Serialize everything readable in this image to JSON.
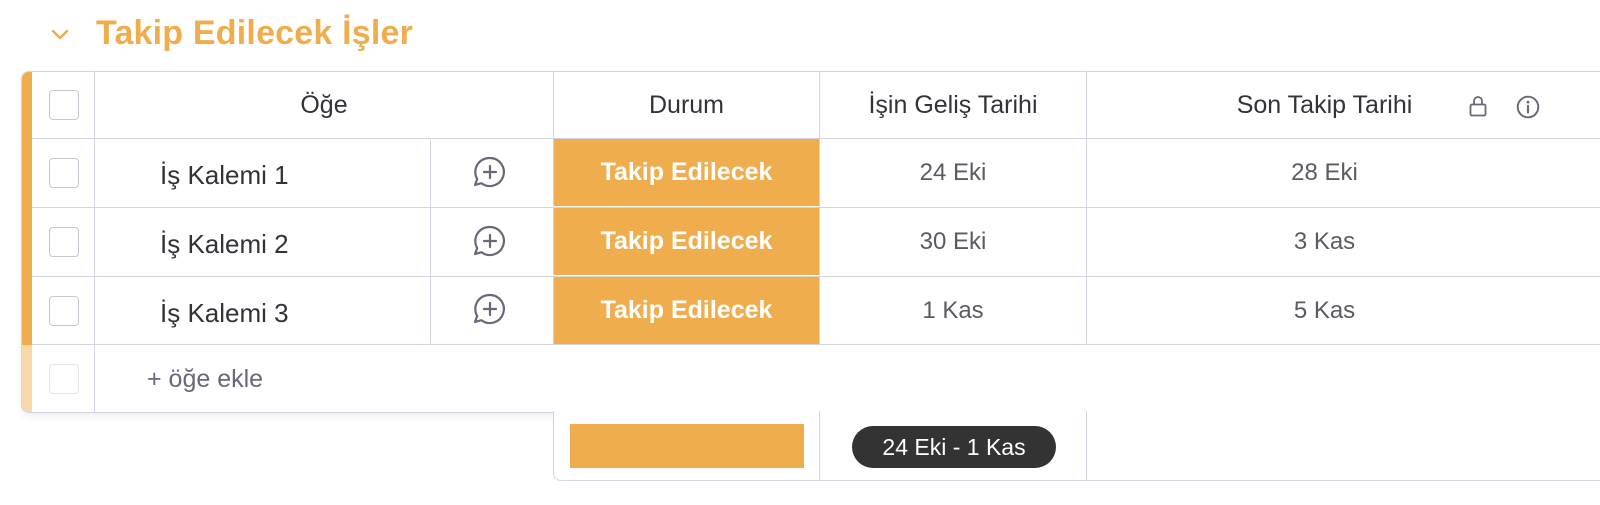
{
  "group": {
    "title": "Takip Edilecek İşler",
    "color": "#f0ad4e"
  },
  "columns": {
    "item": "Öğe",
    "status": "Durum",
    "arrival_date": "İşin Geliş Tarihi",
    "last_followup": "Son Takip Tarihi"
  },
  "rows": [
    {
      "name": "İş Kalemi 1",
      "status": "Takip Edilecek",
      "arrival_date": "24 Eki",
      "last_followup": "28 Eki"
    },
    {
      "name": "İş Kalemi 2",
      "status": "Takip Edilecek",
      "arrival_date": "30 Eki",
      "last_followup": "3 Kas"
    },
    {
      "name": "İş Kalemi 3",
      "status": "Takip Edilecek",
      "arrival_date": "1 Kas",
      "last_followup": "5 Kas"
    }
  ],
  "add_item_label": "+ öğe ekle",
  "summary": {
    "date_range": "24 Eki - 1 Kas"
  },
  "icons": {
    "collapse": "chevron-down-icon",
    "update": "add-update-icon",
    "lock": "lock-icon",
    "info": "info-icon"
  }
}
